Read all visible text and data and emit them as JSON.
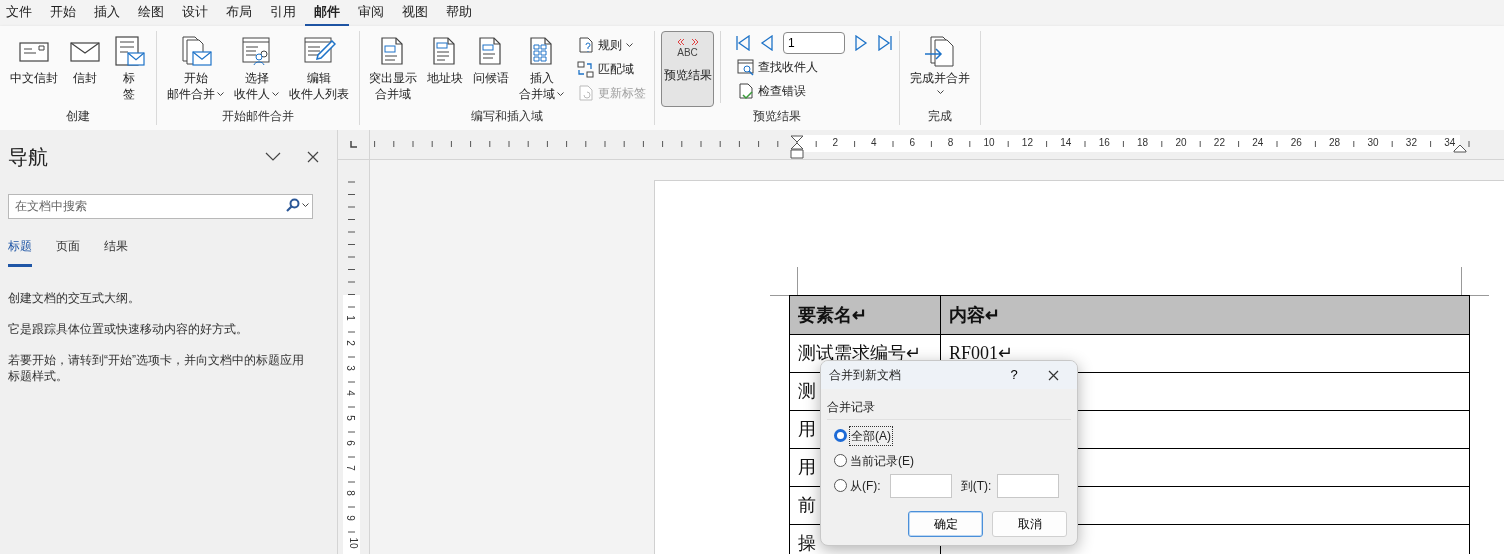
{
  "menu_tabs": [
    {
      "label": "文件",
      "selected": false
    },
    {
      "label": "开始",
      "selected": false
    },
    {
      "label": "插入",
      "selected": false
    },
    {
      "label": "绘图",
      "selected": false
    },
    {
      "label": "设计",
      "selected": false
    },
    {
      "label": "布局",
      "selected": false
    },
    {
      "label": "引用",
      "selected": false
    },
    {
      "label": "邮件",
      "selected": true
    },
    {
      "label": "审阅",
      "selected": false
    },
    {
      "label": "视图",
      "selected": false
    },
    {
      "label": "帮助",
      "selected": false
    }
  ],
  "ribbon_groups": [
    {
      "label": "创建",
      "items": [
        {
          "kind": "large",
          "lines": [
            "中文信封"
          ],
          "dropdown": false
        },
        {
          "kind": "large",
          "lines": [
            "信封"
          ],
          "dropdown": false
        },
        {
          "kind": "large",
          "lines": [
            "标",
            "签"
          ],
          "dropdown": false
        }
      ]
    },
    {
      "label": "开始邮件合并",
      "items": [
        {
          "kind": "large",
          "lines": [
            "开始",
            "邮件合并"
          ],
          "dropdown": true
        },
        {
          "kind": "large",
          "lines": [
            "选择",
            "收件人"
          ],
          "dropdown": true
        },
        {
          "kind": "large",
          "lines": [
            "编辑",
            "收件人列表"
          ],
          "dropdown": false
        }
      ]
    },
    {
      "label": "编写和插入域",
      "items": [
        {
          "kind": "large",
          "lines": [
            "突出显示",
            "合并域"
          ],
          "dropdown": false
        },
        {
          "kind": "large",
          "lines": [
            "地址块"
          ],
          "dropdown": false
        },
        {
          "kind": "large",
          "lines": [
            "问候语"
          ],
          "dropdown": false
        },
        {
          "kind": "large",
          "lines": [
            "插入",
            "合并域"
          ],
          "dropdown": true
        },
        {
          "kind": "stack",
          "buttons": [
            {
              "label": "规则",
              "dropdown": true,
              "disabled": false
            },
            {
              "label": "匹配域",
              "dropdown": false,
              "disabled": false
            },
            {
              "label": "更新标签",
              "dropdown": false,
              "disabled": true
            }
          ]
        }
      ]
    },
    {
      "label": "预览结果",
      "items": [
        {
          "kind": "toggle",
          "badge": "ABC",
          "lines": [
            "预览结果"
          ],
          "selected": true
        },
        {
          "kind": "record_nav",
          "record": "1",
          "buttons": [
            {
              "label": "查找收件人"
            },
            {
              "label": "检查错误"
            }
          ]
        }
      ]
    },
    {
      "label": "完成",
      "items": [
        {
          "kind": "large",
          "lines": [
            "完成并合并"
          ],
          "dropdown": true
        }
      ]
    }
  ],
  "nav_pane": {
    "title": "导航",
    "search_placeholder": "在文档中搜索",
    "tabs": [
      {
        "label": "标题",
        "selected": true
      },
      {
        "label": "页面",
        "selected": false
      },
      {
        "label": "结果",
        "selected": false
      }
    ],
    "paragraphs": [
      "创建文档的交互式大纲。",
      "它是跟踪具体位置或快速移动内容的好方式。",
      "若要开始，请转到“开始”选项卡，并向文档中的标题应用标题样式。"
    ]
  },
  "rulers": {
    "horizontal": [
      "2",
      "4",
      "6",
      "8",
      "10",
      "12",
      "14",
      "16",
      "18",
      "20",
      "22",
      "24",
      "26",
      "28",
      "30",
      "32",
      "34"
    ],
    "vertical": [
      "1",
      "2",
      "3",
      "4",
      "5",
      "6",
      "7",
      "8",
      "9",
      "10"
    ]
  },
  "table": {
    "columns": [
      "要素名↵",
      "内容↵"
    ],
    "rows": [
      {
        "name": "测试需求编号↵",
        "content": "RF001↵"
      },
      {
        "name": "测"
      },
      {
        "name": "用"
      },
      {
        "name": "用"
      },
      {
        "name": "前"
      },
      {
        "name": "操"
      }
    ]
  },
  "dialog": {
    "title": "合并到新文档",
    "help": "?",
    "group_label": "合并记录",
    "options": [
      {
        "label": "全部(A)",
        "selected": true
      },
      {
        "label": "当前记录(E)",
        "selected": false
      },
      {
        "label": "从(F):",
        "selected": false
      }
    ],
    "to_label": "到(T):",
    "buttons": [
      {
        "label": "确定",
        "default": true
      },
      {
        "label": "取消",
        "default": false
      }
    ]
  }
}
